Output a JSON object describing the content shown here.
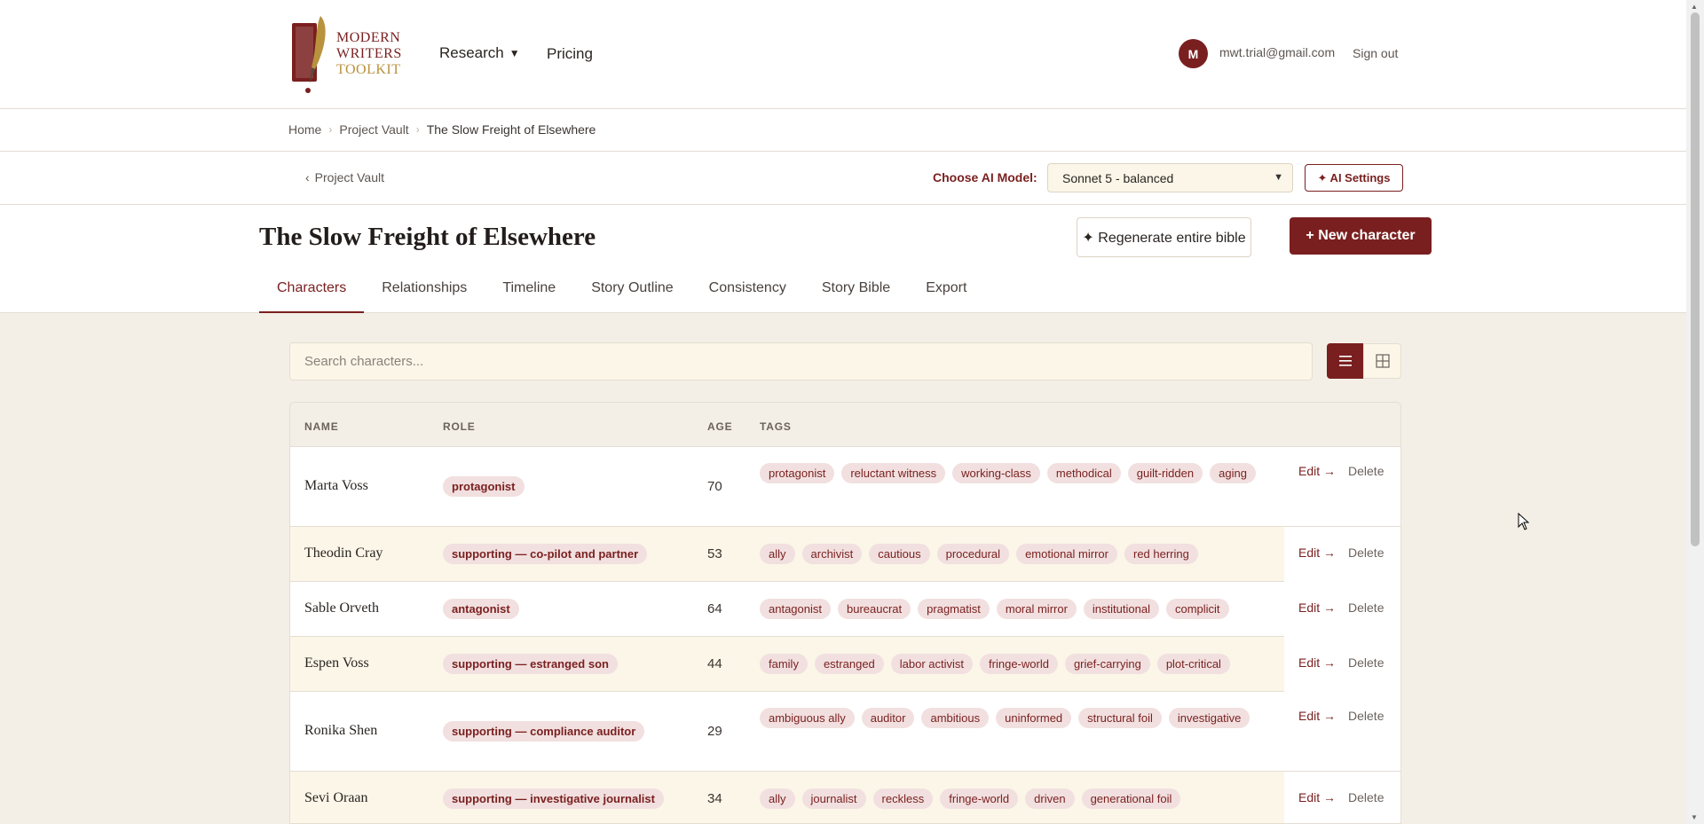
{
  "brand": {
    "line1": "MODERN",
    "line2": "WRITERS",
    "line3": "TOOLKIT",
    "icon": "quill-book-logo",
    "colors": {
      "primary": "#7a1f1f",
      "gold": "#b8923d"
    }
  },
  "nav": {
    "research": "Research",
    "pricing": "Pricing"
  },
  "user": {
    "initial": "M",
    "email": "mwt.trial@gmail.com",
    "signout": "Sign out"
  },
  "breadcrumb": [
    "Home",
    "Project Vault",
    "The Slow Freight of Elsewhere"
  ],
  "toolbar": {
    "back": "Project Vault",
    "model_label": "Choose AI Model:",
    "model_value": "Sonnet 5 - balanced",
    "ai_settings": "✦ AI Settings"
  },
  "project": {
    "title": "The Slow Freight of Elsewhere",
    "regen": "✦ Regenerate entire bible",
    "new_character": "+ New character"
  },
  "tabs": [
    "Characters",
    "Relationships",
    "Timeline",
    "Story Outline",
    "Consistency",
    "Story Bible",
    "Export"
  ],
  "search": {
    "placeholder": "Search characters..."
  },
  "table": {
    "headers": {
      "name": "NAME",
      "role": "ROLE",
      "age": "AGE",
      "tags": "TAGS"
    },
    "edit": "Edit →",
    "delete": "Delete",
    "rows": [
      {
        "name": "Marta Voss",
        "role": "protagonist",
        "age": "70",
        "tags": [
          "protagonist",
          "reluctant witness",
          "working-class",
          "methodical",
          "guilt-ridden",
          "aging"
        ]
      },
      {
        "name": "Theodin Cray",
        "role": "supporting — co-pilot and partner",
        "age": "53",
        "tags": [
          "ally",
          "archivist",
          "cautious",
          "procedural",
          "emotional mirror",
          "red herring"
        ]
      },
      {
        "name": "Sable Orveth",
        "role": "antagonist",
        "age": "64",
        "tags": [
          "antagonist",
          "bureaucrat",
          "pragmatist",
          "moral mirror",
          "institutional",
          "complicit"
        ]
      },
      {
        "name": "Espen Voss",
        "role": "supporting — estranged son",
        "age": "44",
        "tags": [
          "family",
          "estranged",
          "labor activist",
          "fringe-world",
          "grief-carrying",
          "plot-critical"
        ]
      },
      {
        "name": "Ronika Shen",
        "role": "supporting — compliance auditor",
        "age": "29",
        "tags": [
          "ambiguous ally",
          "auditor",
          "ambitious",
          "uninformed",
          "structural foil",
          "investigative"
        ]
      },
      {
        "name": "Sevi Oraan",
        "role": "supporting — investigative journalist",
        "age": "34",
        "tags": [
          "ally",
          "journalist",
          "reckless",
          "fringe-world",
          "driven",
          "generational foil"
        ]
      }
    ]
  }
}
